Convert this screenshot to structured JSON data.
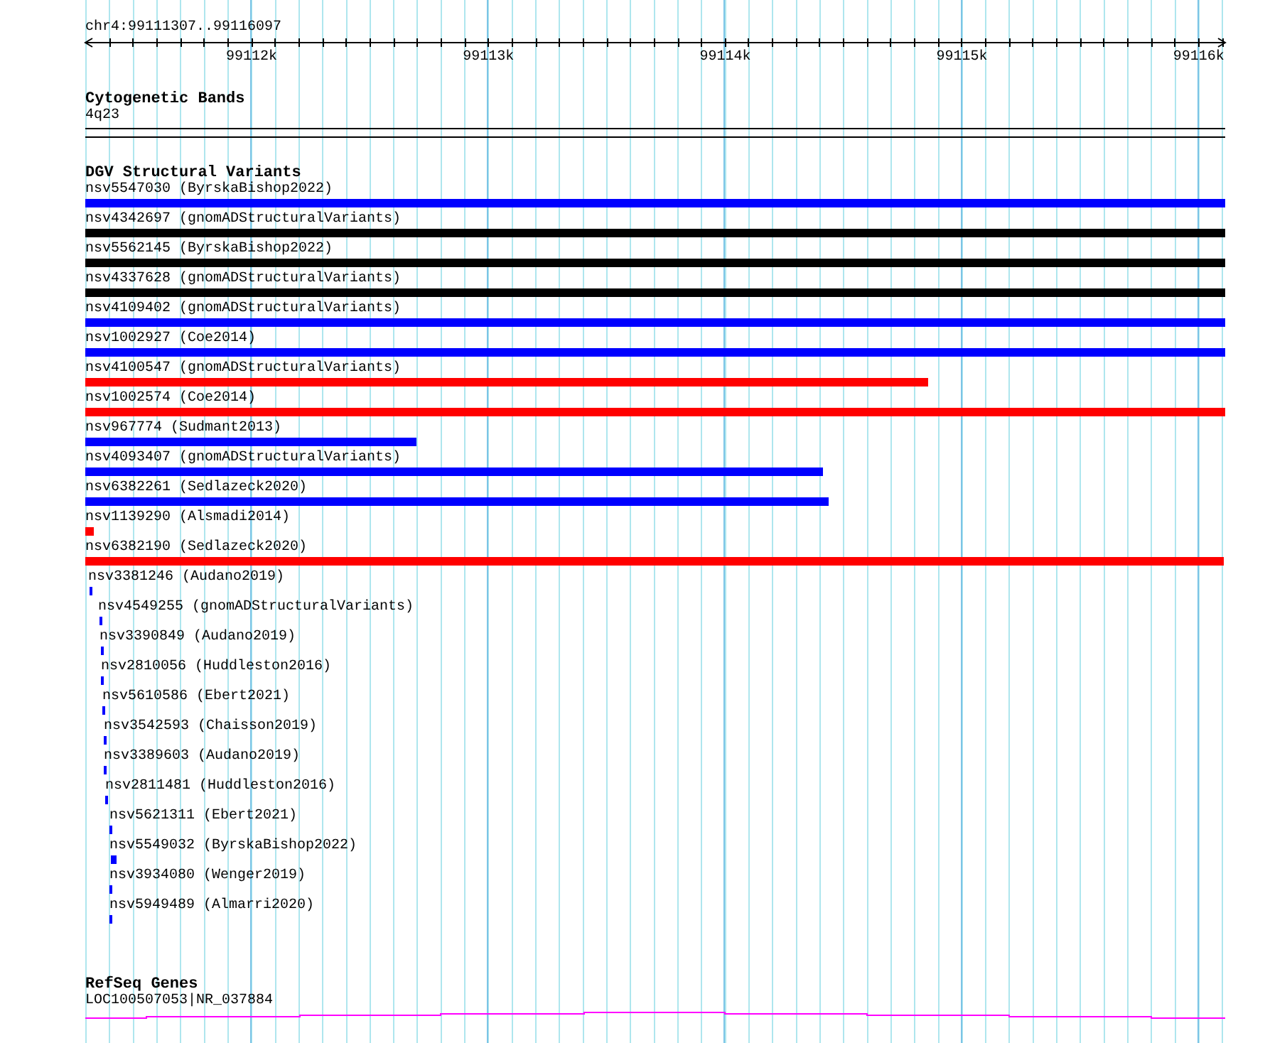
{
  "location": "chr4:99111307..99116097",
  "ruler": {
    "ticks": [
      "99112k",
      "99113k",
      "99114k",
      "99115k",
      "99116k"
    ]
  },
  "tracks": [
    {
      "kind": "cytoband",
      "title": "Cytogenetic Bands",
      "features": [
        {
          "label": "4q23"
        }
      ]
    },
    {
      "kind": "variants",
      "title": "DGV Structural Variants",
      "features": [
        {
          "label": "nsv5547030 (ByrskaBishop2022)",
          "color": "#0000ff"
        },
        {
          "label": "nsv4342697 (gnomADStructuralVariants)",
          "color": "#000000"
        },
        {
          "label": "nsv5562145 (ByrskaBishop2022)",
          "color": "#000000"
        },
        {
          "label": "nsv4337628 (gnomADStructuralVariants)",
          "color": "#000000"
        },
        {
          "label": "nsv4109402 (gnomADStructuralVariants)",
          "color": "#0000ff"
        },
        {
          "label": "nsv1002927 (Coe2014)",
          "color": "#0000ff"
        },
        {
          "label": "nsv4100547 (gnomADStructuralVariants)",
          "color": "#ff0000"
        },
        {
          "label": "nsv1002574 (Coe2014)",
          "color": "#ff0000"
        },
        {
          "label": "nsv967774 (Sudmant2013)",
          "color": "#0000ff"
        },
        {
          "label": "nsv4093407 (gnomADStructuralVariants)",
          "color": "#0000ff"
        },
        {
          "label": "nsv6382261 (Sedlazeck2020)",
          "color": "#0000ff"
        },
        {
          "label": "nsv1139290 (Alsmadi2014)",
          "color": "#ff0000"
        },
        {
          "label": "nsv6382190 (Sedlazeck2020)",
          "color": "#ff0000"
        },
        {
          "label": "nsv3381246 (Audano2019)",
          "color": "#0000ff"
        },
        {
          "label": "nsv4549255 (gnomADStructuralVariants)",
          "color": "#0000ff"
        },
        {
          "label": "nsv3390849 (Audano2019)",
          "color": "#0000ff"
        },
        {
          "label": "nsv2810056 (Huddleston2016)",
          "color": "#0000ff"
        },
        {
          "label": "nsv5610586 (Ebert2021)",
          "color": "#0000ff"
        },
        {
          "label": "nsv3542593 (Chaisson2019)",
          "color": "#0000ff"
        },
        {
          "label": "nsv3389603 (Audano2019)",
          "color": "#0000ff"
        },
        {
          "label": "nsv2811481 (Huddleston2016)",
          "color": "#0000ff"
        },
        {
          "label": "nsv5621311 (Ebert2021)",
          "color": "#0000ff"
        },
        {
          "label": "nsv5549032 (ByrskaBishop2022)",
          "color": "#0000ff"
        },
        {
          "label": "nsv3934080 (Wenger2019)",
          "color": "#0000ff"
        },
        {
          "label": "nsv5949489 (Almarri2020)",
          "color": "#0000ff"
        }
      ]
    },
    {
      "kind": "genes",
      "title": "RefSeq Genes",
      "features": [
        {
          "label": "LOC100507053|NR_037884"
        }
      ]
    }
  ]
}
